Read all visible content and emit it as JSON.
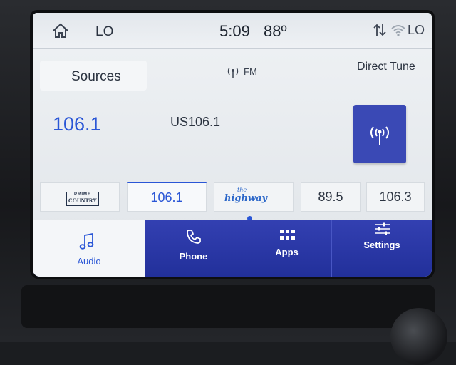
{
  "status_bar": {
    "home_icon": "home-icon",
    "climate_mode": "LO",
    "time": "5:09",
    "temperature": "88º",
    "right_climate_mode": "LO",
    "sync_icon": "sync-arrows-icon",
    "wifi_icon": "wifi-icon"
  },
  "radio": {
    "sources_label": "Sources",
    "band_label": "FM",
    "band_icon": "antenna-icon",
    "direct_tune_label": "Direct Tune",
    "direct_tune_icon": "antenna-broadcast-icon",
    "current_frequency": "106.1",
    "station_name": "US106.1"
  },
  "presets": [
    {
      "type": "logo",
      "logo": "prime-country-logo",
      "logo_line1": "PRIME",
      "logo_line2": "COUNTRY"
    },
    {
      "type": "text",
      "label": "106.1",
      "active": true
    },
    {
      "type": "logo",
      "logo": "highway-logo",
      "logo_line1": "the",
      "logo_line2": "highway"
    },
    {
      "type": "text",
      "label": "89.5"
    },
    {
      "type": "text",
      "label": "106.3"
    }
  ],
  "nav": {
    "audio": {
      "label": "Audio",
      "icon": "music-note-icon",
      "active": true
    },
    "phone": {
      "label": "Phone",
      "icon": "phone-icon"
    },
    "apps": {
      "label": "Apps",
      "icon": "apps-grid-icon"
    },
    "settings": {
      "label": "Settings",
      "icon": "sliders-icon"
    }
  },
  "colors": {
    "accent_blue": "#2a56d6",
    "nav_background": "#2a37a8",
    "direct_tune_button": "#3a49b5"
  }
}
